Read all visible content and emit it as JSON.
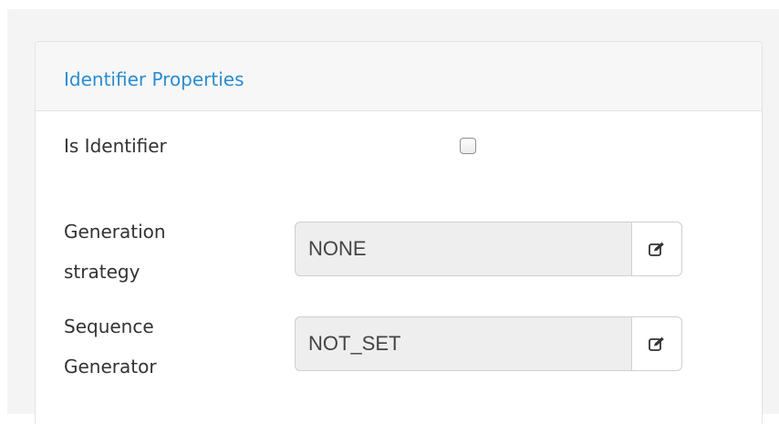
{
  "panel": {
    "title": "Identifier Properties"
  },
  "fields": {
    "is_identifier": {
      "label": "Is Identifier",
      "checked": false
    },
    "generation_strategy": {
      "label_line1": "Generation",
      "label_line2": "strategy",
      "value": "NONE",
      "action_icon": "edit-icon"
    },
    "sequence_generator": {
      "label_line1": "Sequence",
      "label_line2": "Generator",
      "value": "NOT_SET",
      "action_icon": "edit-icon"
    }
  },
  "colors": {
    "title": "#2a8cd0",
    "text": "#333333",
    "input_bg": "#eeeeee",
    "border": "#cfcfcf"
  }
}
